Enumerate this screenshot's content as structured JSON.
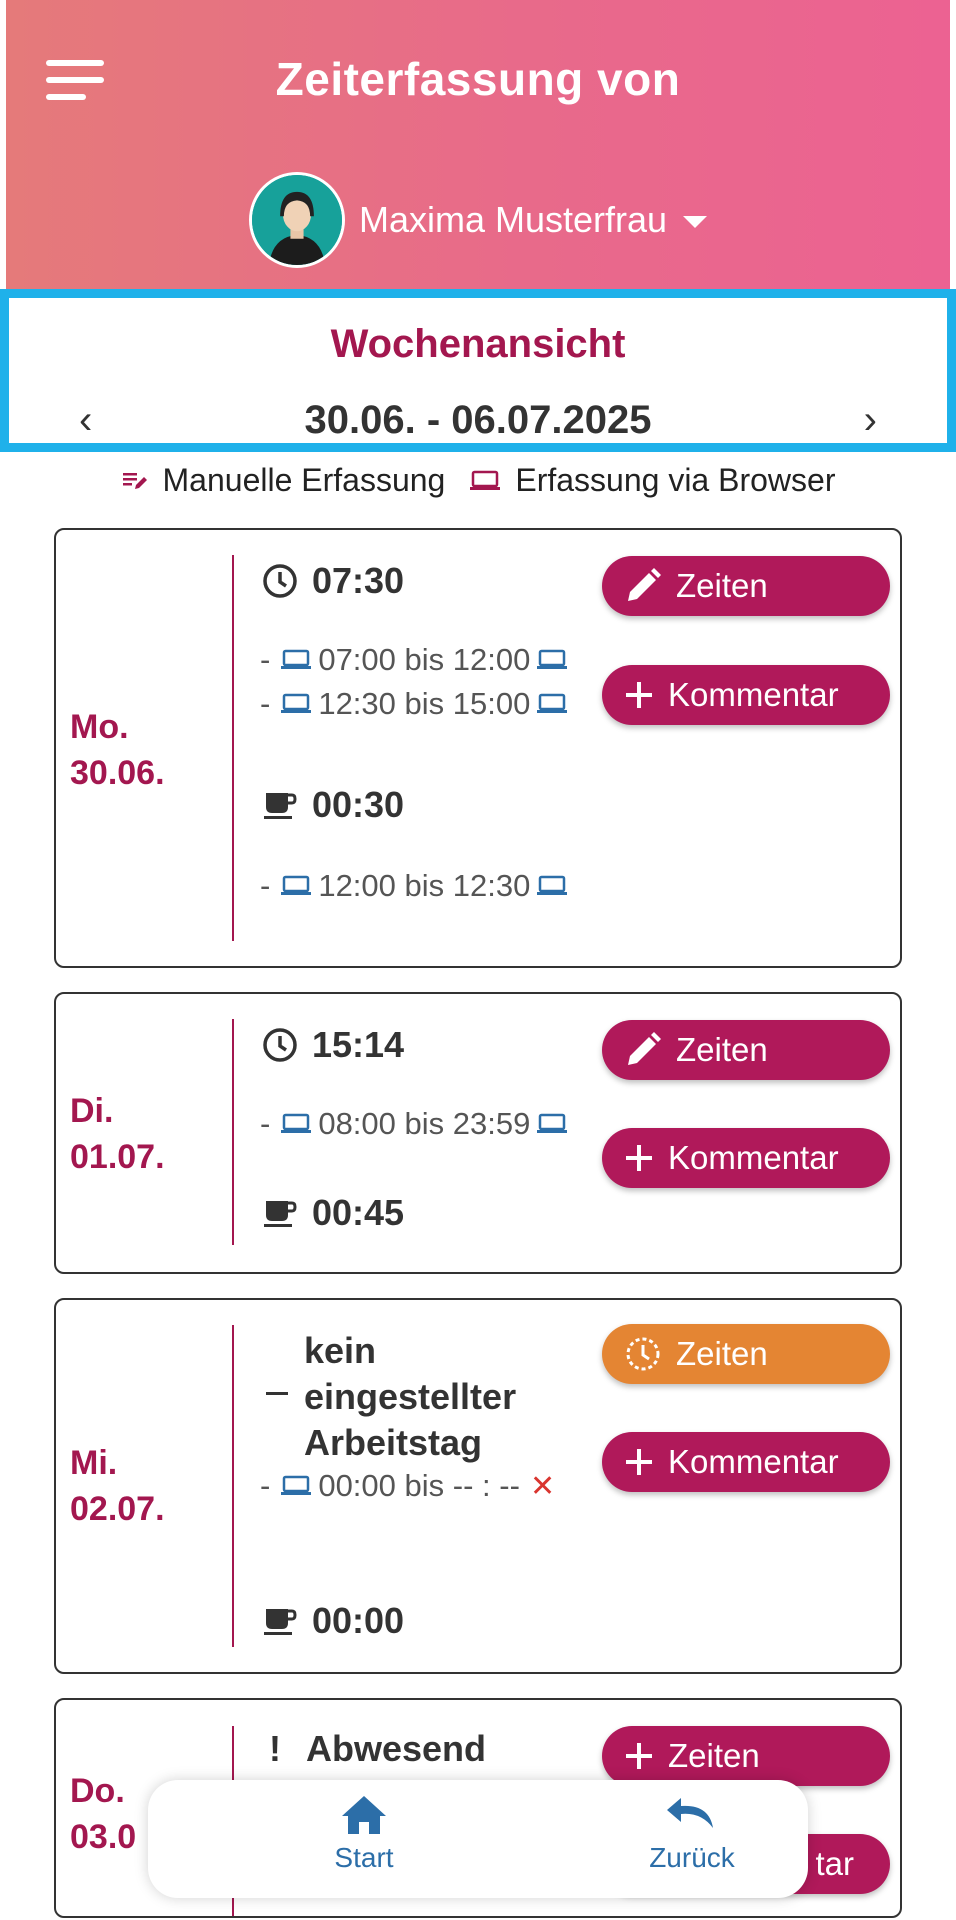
{
  "header": {
    "title": "Zeiterfassung von",
    "user_name": "Maxima Musterfrau",
    "color": "#e86a8a"
  },
  "week": {
    "title": "Wochenansicht",
    "range": "30.06. - 06.07.2025",
    "prev": "‹",
    "next": "›"
  },
  "legend": {
    "manual": "Manuelle Erfassung",
    "browser": "Erfassung via Browser"
  },
  "days": [
    {
      "weekday": "Mo.",
      "date": "30.06.",
      "work_total": "07:30",
      "entries": [
        {
          "from": "07:00",
          "to": "12:00"
        },
        {
          "from": "12:30",
          "to": "15:00"
        }
      ],
      "break_total": "00:30",
      "break_entries": [
        {
          "from": "12:00",
          "to": "12:30"
        }
      ],
      "times_button": "Zeiten",
      "comment_button": "Kommentar"
    },
    {
      "weekday": "Di.",
      "date": "01.07.",
      "work_total": "15:14",
      "entries": [
        {
          "from": "08:00",
          "to": "23:59"
        }
      ],
      "break_total": "00:45",
      "times_button": "Zeiten",
      "comment_button": "Kommentar"
    },
    {
      "weekday": "Mi.",
      "date": "02.07.",
      "status_lines": [
        "kein",
        "eingestellter",
        "Arbeitstag"
      ],
      "entries": [
        {
          "from": "00:00",
          "to": "-- : --"
        }
      ],
      "break_total": "00:00",
      "times_button": "Zeiten",
      "comment_button": "Kommentar"
    },
    {
      "weekday": "Do.",
      "date": "03.0",
      "status": "Abwesend",
      "times_button": "Zeiten",
      "comment_button_partial": "tar"
    }
  ],
  "connector": "bis",
  "bottom_nav": {
    "start": "Start",
    "back": "Zurück"
  },
  "colors": {
    "accent": "#a3174f",
    "button": "#b0195a",
    "orange": "#e48533",
    "highlight": "#1fb1ea",
    "device": "#2c6ea8"
  }
}
